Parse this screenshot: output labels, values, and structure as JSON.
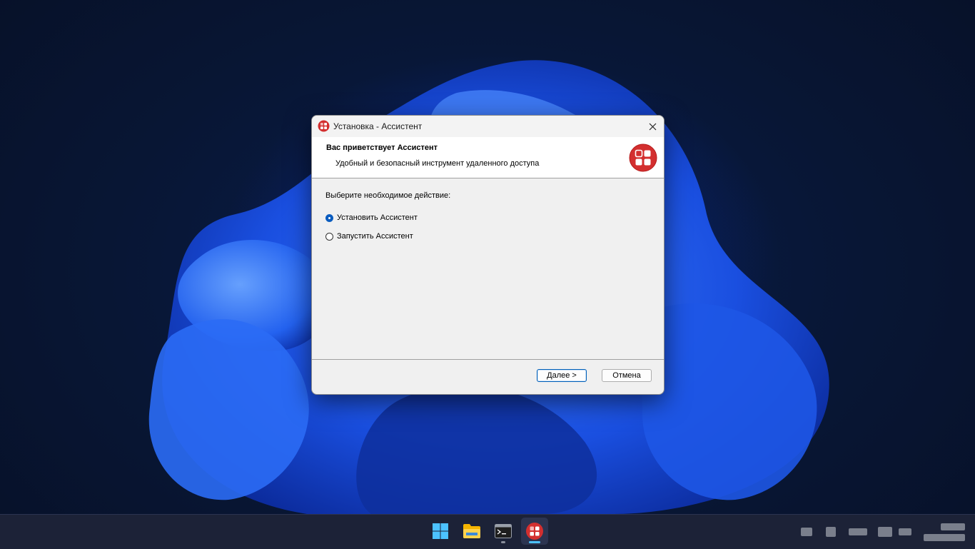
{
  "window": {
    "title": "Установка - Ассистент",
    "close_icon": "close-icon"
  },
  "header": {
    "title": "Вас приветствует Ассистент",
    "subtitle": "Удобный и безопасный инструмент удаленного доступа",
    "logo_icon": "assistant-logo-icon"
  },
  "content": {
    "prompt": "Выберите необходимое действие:",
    "options": [
      {
        "label": "Установить Ассистент",
        "checked": true
      },
      {
        "label": "Запустить Ассистент",
        "checked": false
      }
    ]
  },
  "buttons": {
    "next_label": "Далее >",
    "cancel_label": "Отмена"
  },
  "taskbar": {
    "items": [
      {
        "icon": "windows-start-icon"
      },
      {
        "icon": "file-explorer-icon"
      },
      {
        "icon": "terminal-icon"
      },
      {
        "icon": "assistant-app-icon"
      }
    ]
  },
  "colors": {
    "accent": "#005fb8",
    "logo_red": "#d32f2f",
    "taskbar_bg": "#1c2237"
  }
}
